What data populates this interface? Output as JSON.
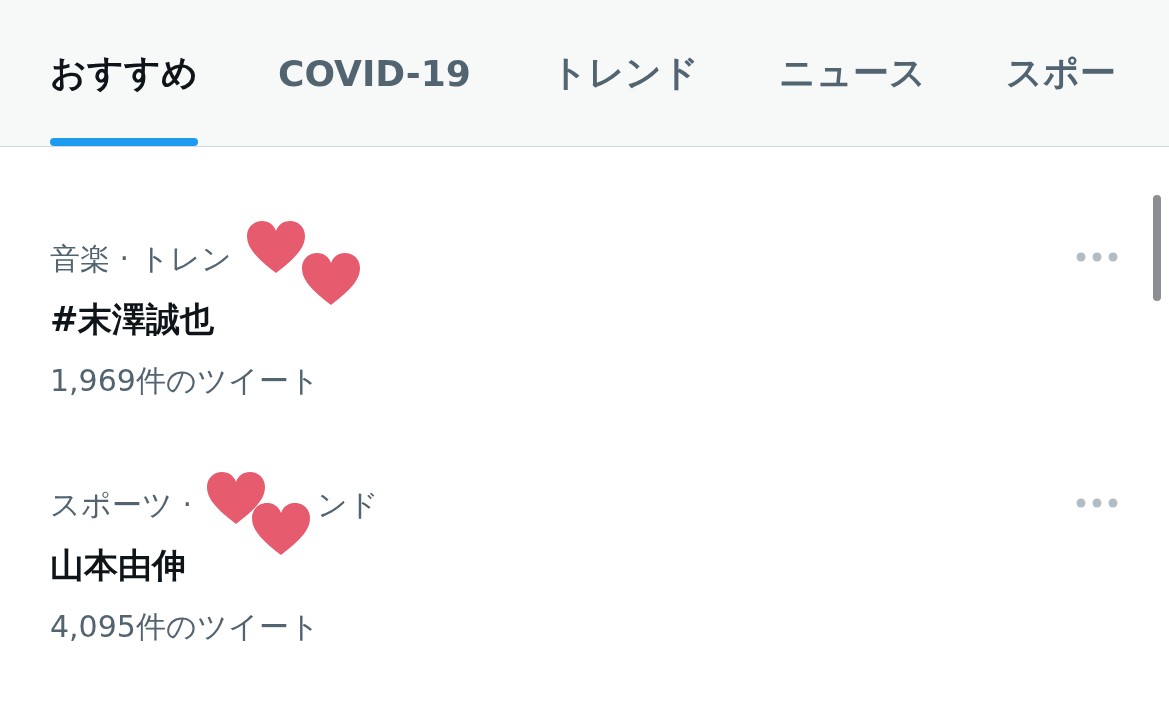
{
  "tabs": [
    {
      "label": "おすすめ",
      "selected": true
    },
    {
      "label": "COVID-19",
      "selected": false
    },
    {
      "label": "トレンド",
      "selected": false
    },
    {
      "label": "ニュース",
      "selected": false
    },
    {
      "label": "スポー",
      "selected": false
    }
  ],
  "trends": [
    {
      "category_parts": [
        "音楽 · トレン"
      ],
      "title": "#末澤誠也",
      "count": "1,969件のツイート"
    },
    {
      "category_parts": [
        "スポーツ ·",
        "ンド"
      ],
      "title": "山本由伸",
      "count": "4,095件のツイート"
    }
  ]
}
